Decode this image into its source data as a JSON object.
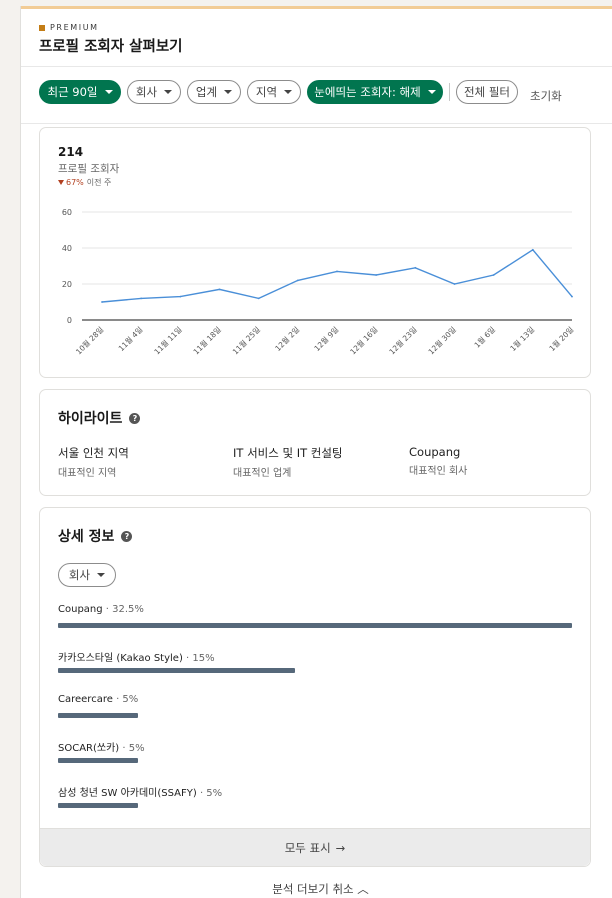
{
  "header": {
    "badge": "PREMIUM",
    "title": "프로필 조회자 살펴보기"
  },
  "filters": {
    "time": "최근 90일",
    "company": "회사",
    "industry": "업계",
    "region": "지역",
    "notable": "눈에띄는 조회자: 해제",
    "all_filters": "전체 필터",
    "reset": "초기화"
  },
  "stats": {
    "count": "214",
    "label": "프로필 조회자",
    "delta": "67%",
    "delta_suffix": "이전 주"
  },
  "chart_data": {
    "type": "line",
    "x": [
      "10월 28일",
      "11월 4일",
      "11월 11일",
      "11월 18일",
      "11월 25일",
      "12월 2일",
      "12월 9일",
      "12월 16일",
      "12월 23일",
      "12월 30일",
      "1월 6일",
      "1월 13일",
      "1월 20일"
    ],
    "series": [
      {
        "values": [
          10,
          12,
          13,
          17,
          12,
          22,
          27,
          25,
          29,
          20,
          25,
          39,
          13
        ]
      }
    ],
    "yticks": [
      0,
      20,
      40,
      60
    ],
    "ylim": [
      0,
      60
    ],
    "grid": true,
    "color": "#4a8fd8"
  },
  "highlights": {
    "title": "하이라이트",
    "items": [
      {
        "value": "서울 인천 지역",
        "sub": "대표적인 지역"
      },
      {
        "value": "IT 서비스 및 IT 컨설팅",
        "sub": "대표적인 업계"
      },
      {
        "value": "Coupang",
        "sub": "대표적인 회사"
      }
    ]
  },
  "details": {
    "title": "상세 정보",
    "dropdown": "회사",
    "rows": [
      {
        "name": "Coupang",
        "pct": "· 32.5%",
        "fraction": 1.0
      },
      {
        "name": "카카오스타일 (Kakao Style)",
        "pct": "· 15%",
        "fraction": 0.462
      },
      {
        "name": "Careercare",
        "pct": "· 5%",
        "fraction": 0.155
      },
      {
        "name": "SOCAR(쏘카)",
        "pct": "· 5%",
        "fraction": 0.155
      },
      {
        "name": "삼성 청년 SW 아카데미(SSAFY)",
        "pct": "· 5%",
        "fraction": 0.155
      }
    ],
    "show_all": "모두 표시"
  },
  "footer": {
    "collapse": "분석 더보기 취소"
  },
  "colors": {
    "accent": "#01754f",
    "bar": "#56687a",
    "delta": "#b24020"
  }
}
